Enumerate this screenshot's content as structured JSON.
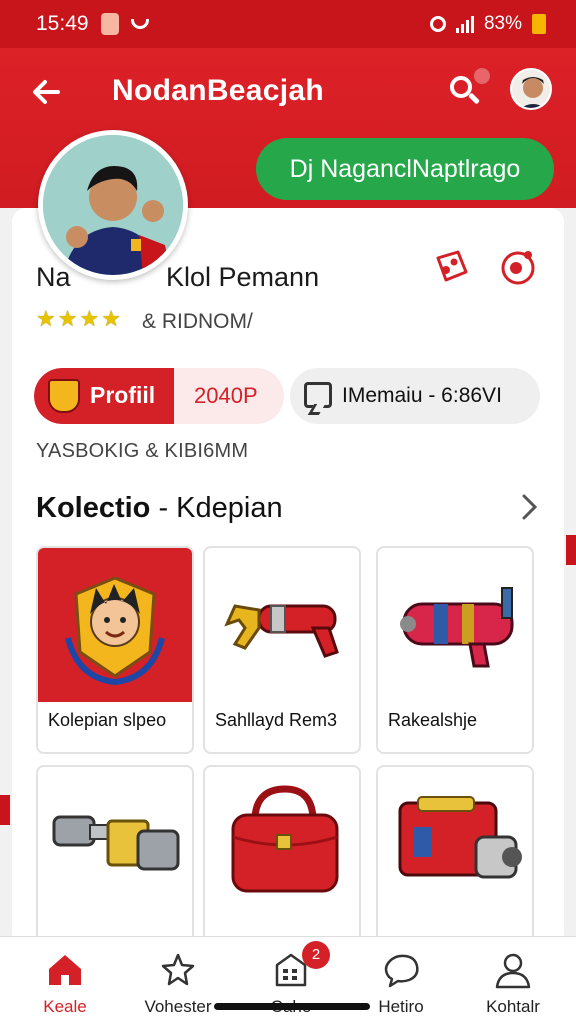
{
  "status_bar": {
    "time": "15:49",
    "battery": "83%"
  },
  "app_bar": {
    "title": "NodanBeacjah",
    "action_button": "Dj NaganclNaptlrago"
  },
  "profile": {
    "name_first": "Na",
    "name_rest": "Klol Pemann",
    "rating_stars": 4,
    "rating_text": "& RIDNOM/",
    "profile_pill_label": "Profiil",
    "profile_pill_value": "2040P",
    "message_pill_label": "IMemaiu - 6:86VI",
    "stats_text": "YASBOKIG & KIBI6MM"
  },
  "collection": {
    "title_bold": "Kolectio",
    "title_rest": "- Kdepian",
    "items": [
      {
        "caption": "Kolepian slpeo",
        "icon": "player-crest-icon"
      },
      {
        "caption": "Sahllayd Rem3",
        "icon": "claw-blaster-icon"
      },
      {
        "caption": "Rakealshje",
        "icon": "blaster-gun-icon"
      },
      {
        "caption": "",
        "icon": "dumbbell-icon"
      },
      {
        "caption": "",
        "icon": "handbag-icon"
      },
      {
        "caption": "",
        "icon": "cannon-icon"
      }
    ]
  },
  "bottom_nav": {
    "items": [
      {
        "label": "Keale",
        "icon": "home-icon"
      },
      {
        "label": "Vohester",
        "icon": "stars-icon"
      },
      {
        "label": "Cahe",
        "icon": "calendar-icon",
        "badge": "2"
      },
      {
        "label": "Hetiro",
        "icon": "chat-icon"
      },
      {
        "label": "Kohtalr",
        "icon": "person-icon"
      }
    ]
  },
  "colors": {
    "primary": "#d42128",
    "accent_green": "#25a74a"
  }
}
